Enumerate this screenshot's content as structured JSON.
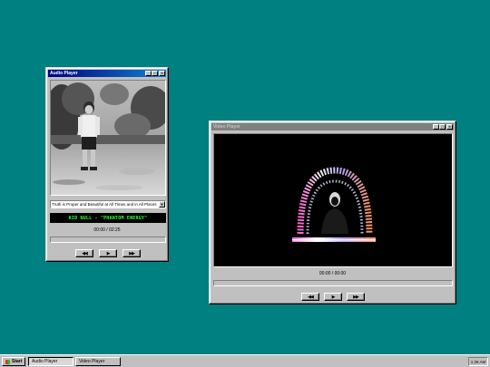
{
  "audio_player": {
    "title": "Audio Player",
    "track_select": "Truth is Proper and Beautiful at All Times and in All Places",
    "now_playing": "KID NULL - \"PHANTOM ENERGY\"",
    "time": "00:00 / 02:25",
    "progress": 0,
    "controls": {
      "rewind": "◀◀",
      "play": "▶",
      "forward": "▶▶"
    }
  },
  "video_player": {
    "title": "Video Player",
    "time": "00:00 / 00:00",
    "progress": 0,
    "controls": {
      "rewind": "◀◀",
      "play": "▶",
      "forward": "▶▶"
    }
  },
  "window_buttons": {
    "minimize": "_",
    "maximize": "□",
    "close": "×"
  },
  "taskbar": {
    "start_label": "Start",
    "items": [
      {
        "label": "Audio Player",
        "active": true
      },
      {
        "label": "Video Player",
        "active": false
      }
    ],
    "clock": "1:28 AM"
  },
  "colors": {
    "desktop": "#008080",
    "title_active": "#000080",
    "title_inactive": "#808080",
    "now_playing_text": "#33ff33"
  }
}
